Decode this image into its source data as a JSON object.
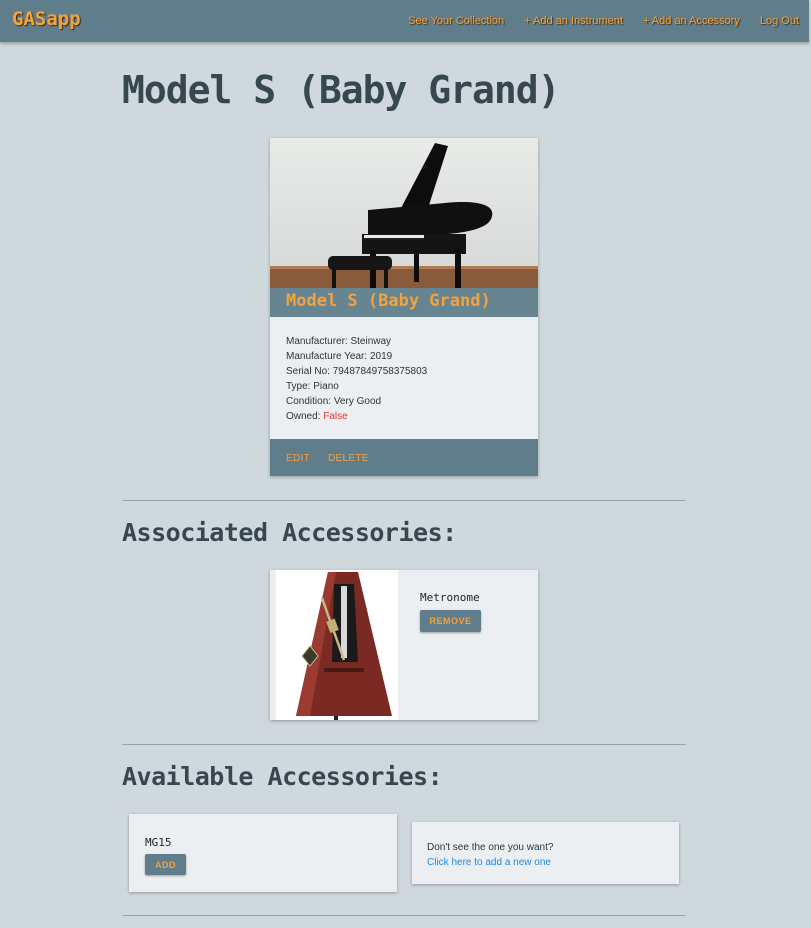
{
  "nav": {
    "brand": "GASapp",
    "links": [
      "See Your Collection",
      "+ Add an Instrument",
      "+ Add an Accessory",
      "Log Out"
    ]
  },
  "page_title": "Model S (Baby Grand)",
  "instrument": {
    "title": "Model S (Baby Grand)",
    "details": [
      {
        "label": "Manufacturer:",
        "value": "Steinway"
      },
      {
        "label": "Manufacture Year:",
        "value": "2019"
      },
      {
        "label": "Serial No:",
        "value": "79487849758375803"
      },
      {
        "label": "Type:",
        "value": "Piano"
      },
      {
        "label": "Condition:",
        "value": "Very Good"
      },
      {
        "label": "Owned:",
        "value": "False"
      }
    ],
    "actions": {
      "edit": "EDIT",
      "delete": "DELETE"
    }
  },
  "associated": {
    "heading": "Associated Accessories:",
    "items": [
      {
        "name": "Metronome",
        "button": "REMOVE"
      }
    ]
  },
  "available": {
    "heading": "Available Accessories:",
    "items": [
      {
        "name": "MG15",
        "button": "ADD"
      }
    ],
    "prompt_text": "Don't see the one you want?",
    "prompt_link": "Click here to add a new one"
  },
  "colors": {
    "nav_bg": "#607d8b",
    "accent": "#f4a23c",
    "page_bg": "#cfd8dc",
    "card_bg": "#eceff1",
    "owned_false": "#e53935",
    "link": "#1e88e5"
  },
  "icons": [
    "piano-photo",
    "metronome-photo"
  ]
}
